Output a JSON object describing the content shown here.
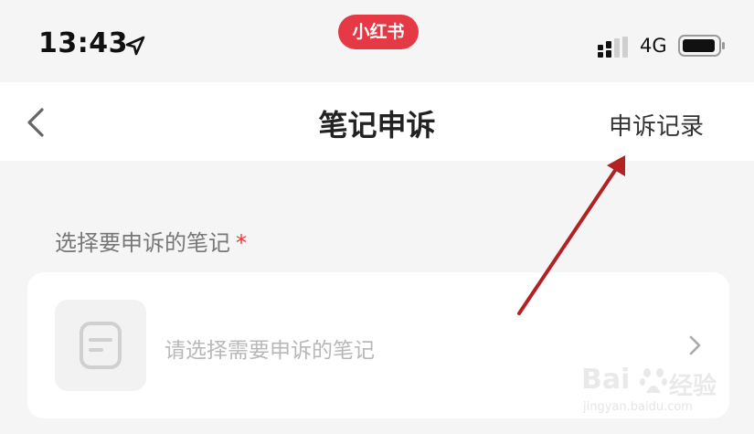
{
  "status_bar": {
    "time": "13:43",
    "app_badge": "小红书",
    "network": "4G",
    "icons": [
      "location-arrow-icon",
      "signal-icon",
      "battery-icon"
    ]
  },
  "nav": {
    "back_icon": "chevron-left-icon",
    "title": "笔记申诉",
    "right_link": "申诉记录"
  },
  "form": {
    "section_label": "选择要申诉的笔记",
    "required_mark": "*",
    "note_picker": {
      "placeholder": "请选择需要申诉的笔记",
      "thumb_icon": "note-icon",
      "chevron_icon": "chevron-right-icon"
    }
  },
  "watermark": {
    "brand": "Bai",
    "brand_cn": "经验",
    "url": "jingyan.baidu.com"
  },
  "colors": {
    "accent_red": "#e53a46",
    "required_red": "#e8383d",
    "annotation_arrow": "#b22222",
    "background": "#f5f5f5"
  }
}
